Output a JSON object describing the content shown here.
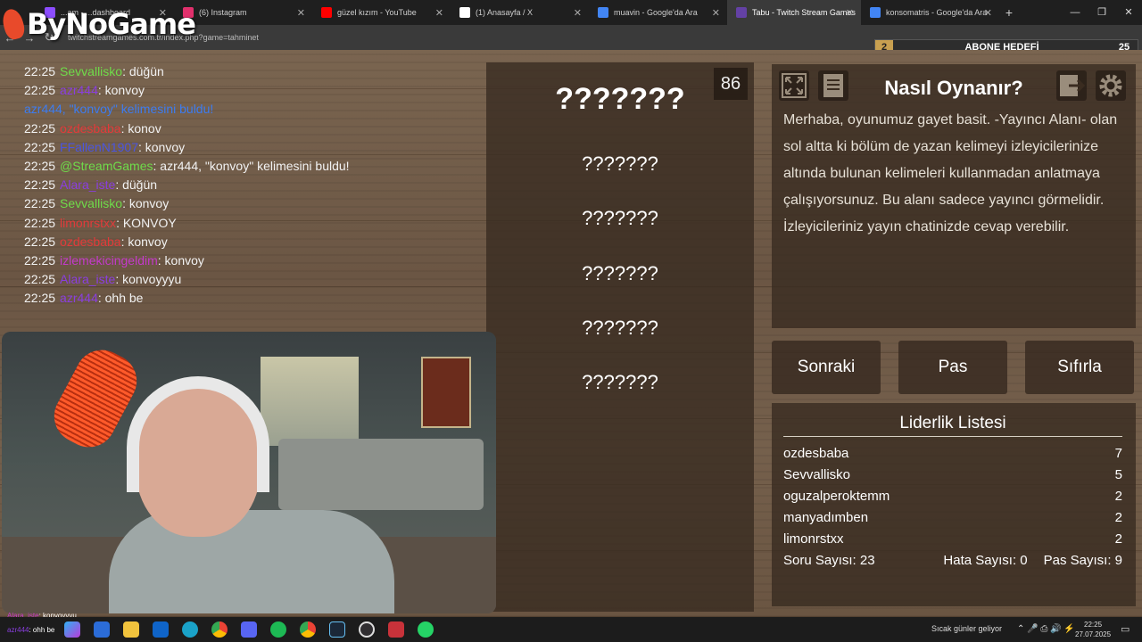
{
  "browser": {
    "tabs": [
      {
        "label": "...am - ...dashboard",
        "color": "#8c4dff"
      },
      {
        "label": "(6) Instagram",
        "color": "#e1306c"
      },
      {
        "label": "güzel kızım - YouTube",
        "color": "#ff0000"
      },
      {
        "label": "(1) Anasayfa / X",
        "color": "#ffffff"
      },
      {
        "label": "muavin - Google'da Ara",
        "color": "#4285f4"
      },
      {
        "label": "Tabu - Twitch Stream Games",
        "color": "#6441a5",
        "active": true
      },
      {
        "label": "konsomatris - Google'da Ara",
        "color": "#4285f4"
      }
    ],
    "url": "twitchstreamgames.com.tr/index.php?game=tahminet"
  },
  "overlay": {
    "logo": "ByNoGame",
    "abone_current": "2",
    "abone_label": "ABONE HEDEFİ",
    "abone_target": "25"
  },
  "chat": [
    {
      "time": "22:25",
      "user": "Sevvallisko",
      "color": "#6fdc4a",
      "msg": ": düğün"
    },
    {
      "time": "22:25",
      "user": "azr444",
      "color": "#8a3ee0",
      "msg": ": konvoy"
    },
    {
      "time": "",
      "user": "azr444, \"konvoy\" kelimesini buldu!",
      "color": "#3d7cf0",
      "msg": "",
      "system": true
    },
    {
      "time": "22:25",
      "user": "ozdesbaba",
      "color": "#e23a3a",
      "msg": ": konov"
    },
    {
      "time": "22:25",
      "user": "FFallenN1907",
      "color": "#4a55e0",
      "msg": ": konvoy"
    },
    {
      "time": "22:25",
      "user": "@StreamGames",
      "color": "#6fdc4a",
      "msg": ": azr444, \"konvoy\" kelimesini buldu!"
    },
    {
      "time": "22:25",
      "user": "Alara_iste",
      "color": "#8a3ee0",
      "msg": ": düğün"
    },
    {
      "time": "22:25",
      "user": "Sevvallisko",
      "color": "#6fdc4a",
      "msg": ": konvoy"
    },
    {
      "time": "22:25",
      "user": "limonrstxx",
      "color": "#e23a3a",
      "msg": ": KONVOY"
    },
    {
      "time": "22:25",
      "user": "ozdesbaba",
      "color": "#e23a3a",
      "msg": ": konvoy"
    },
    {
      "time": "22:25",
      "user": "izlemekicingeldim",
      "color": "#c53acb",
      "msg": ": konvoy"
    },
    {
      "time": "22:25",
      "user": "Alara_iste",
      "color": "#8a3ee0",
      "msg": ": konvoyyyu"
    },
    {
      "time": "22:25",
      "user": "azr444",
      "color": "#8a3ee0",
      "msg": ": ohh be"
    }
  ],
  "game": {
    "timer": "86",
    "main_word": "???????",
    "forbidden": [
      "???????",
      "???????",
      "???????",
      "???????",
      "???????"
    ]
  },
  "how_to": {
    "title": "Nasıl Oynanır?",
    "text": "Merhaba, oyunumuz gayet basit. -Yayıncı Alanı- olan sol altta ki bölüm de yazan kelimeyi izleyicilerinize altında bulunan kelimeleri kullanmadan anlatmaya çalışıyorsunuz. Bu alanı sadece yayıncı görmelidir. İzleyicileriniz yayın chatinizde cevap verebilir."
  },
  "buttons": {
    "next": "Sonraki",
    "pass": "Pas",
    "reset": "Sıfırla"
  },
  "leaderboard": {
    "title": "Liderlik Listesi",
    "rows": [
      {
        "name": "ozdesbaba",
        "score": "7"
      },
      {
        "name": "Sevvallisko",
        "score": "5"
      },
      {
        "name": "oguzalperoktemm",
        "score": "2"
      },
      {
        "name": "manyadımben",
        "score": "2"
      },
      {
        "name": "limonrstxx",
        "score": "2"
      }
    ],
    "questions": "Soru Sayısı: 23",
    "errors": "Hata Sayısı: 0",
    "passes": "Pas Sayısı: 9"
  },
  "taskbar": {
    "overlay_chat_user": "Alara_iste",
    "overlay_chat_msg": ": konvoyyyu",
    "overlay_chat_user2": "azr444",
    "overlay_chat_msg2": ": ohh be",
    "weather": "Sıcak günler geliyor",
    "time": "22:25",
    "date": "27.07.2025"
  }
}
